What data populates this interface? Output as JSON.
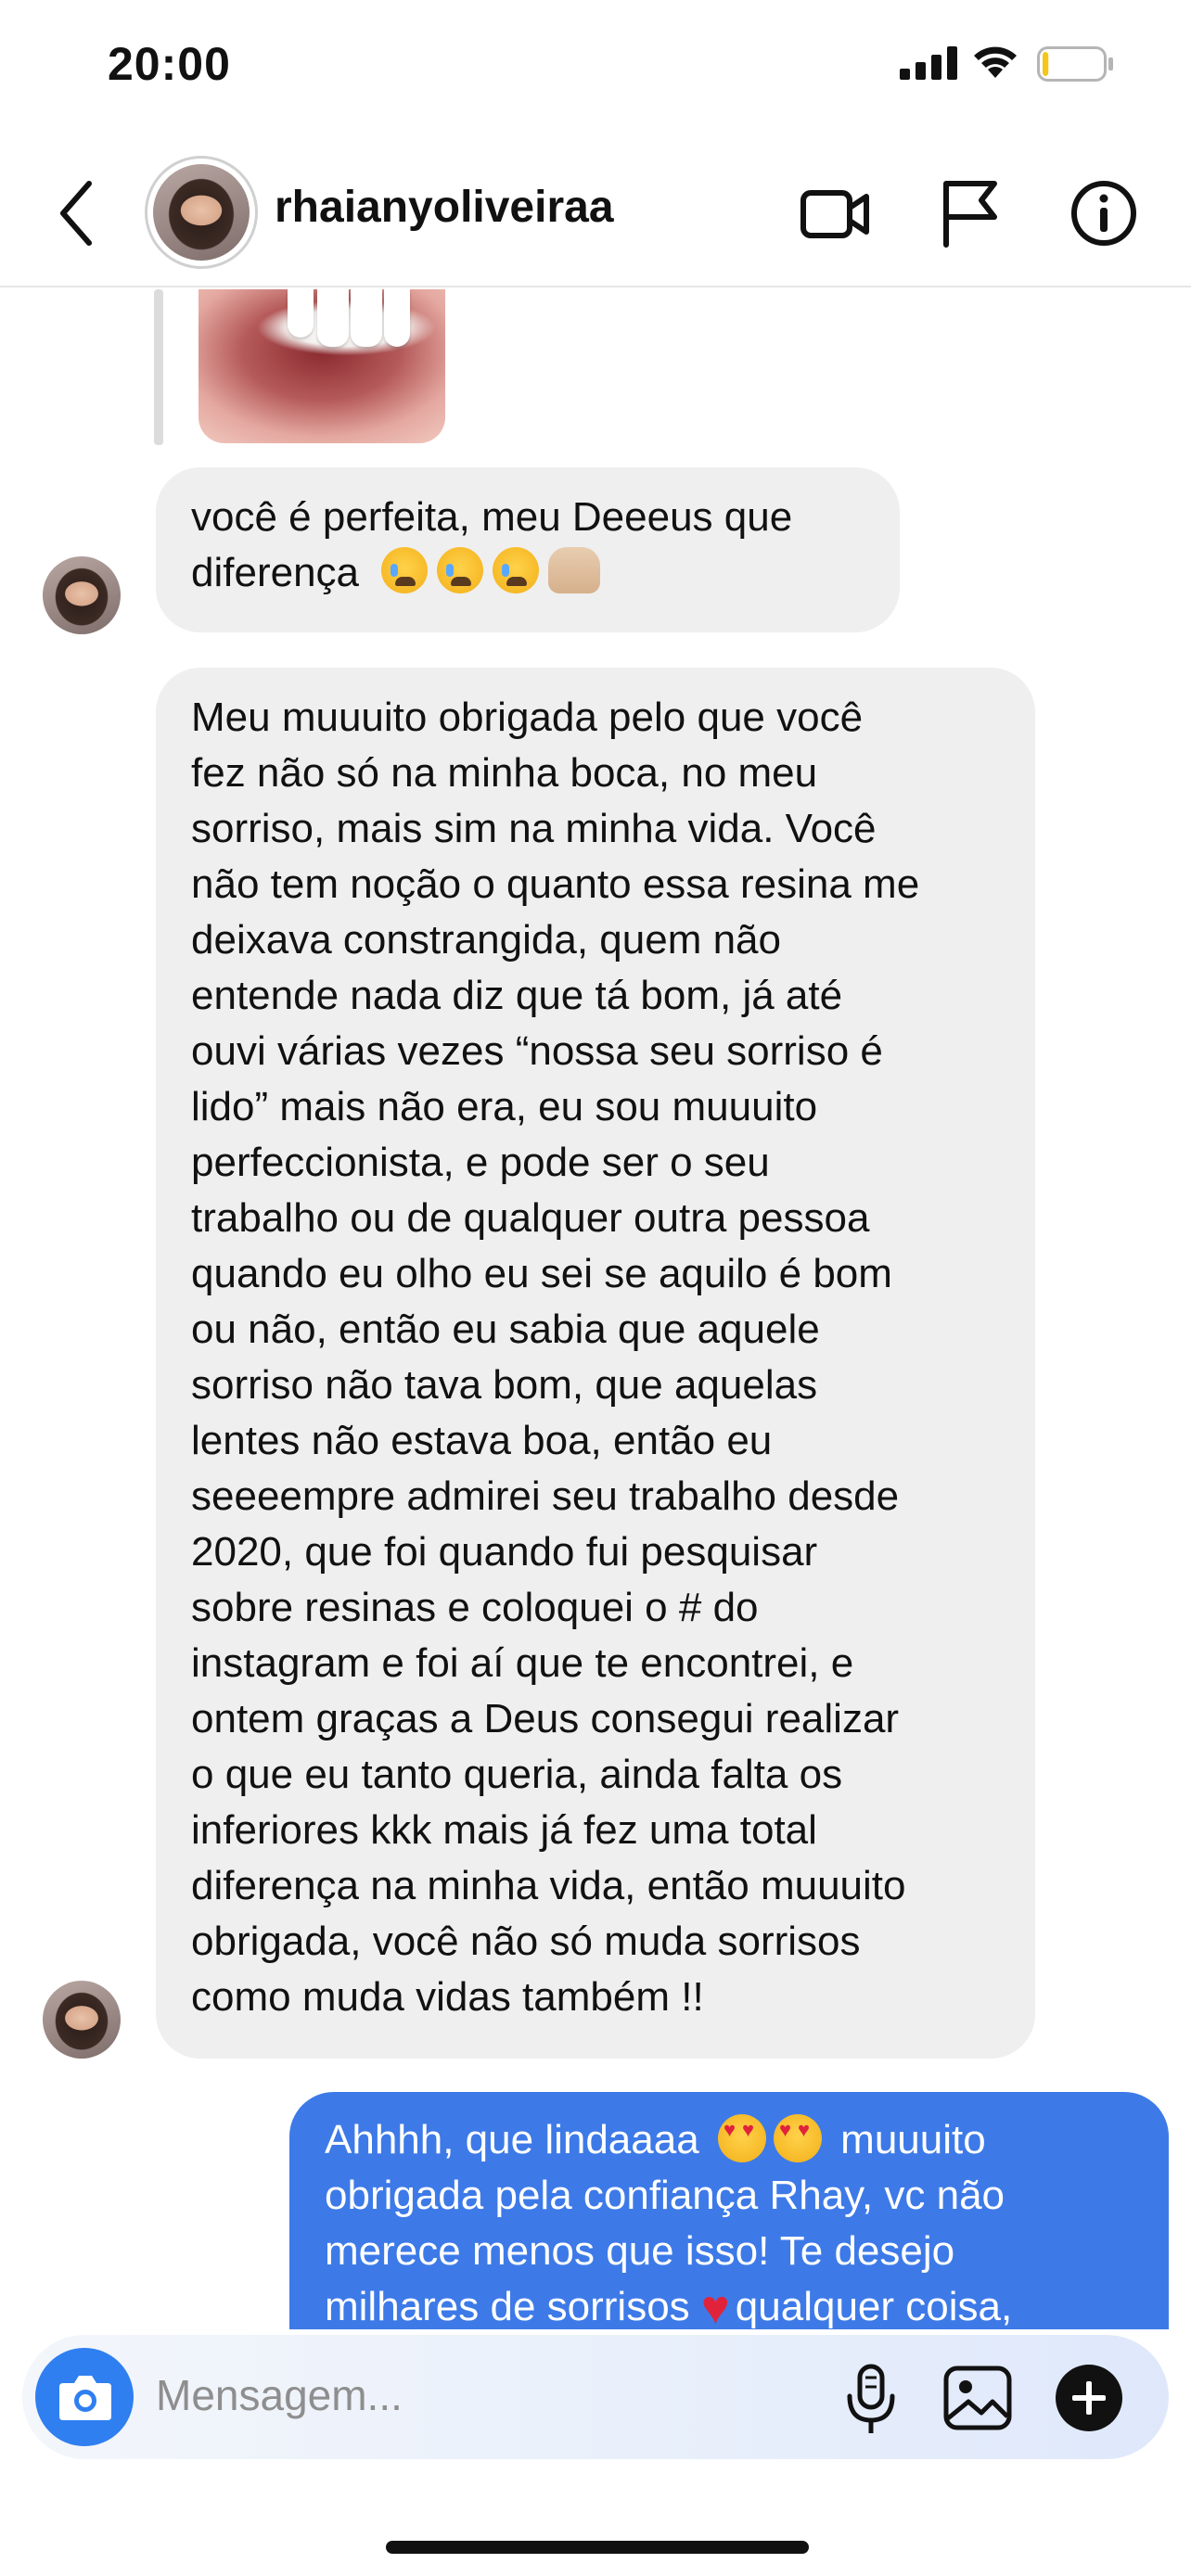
{
  "status_bar": {
    "time": "20:00",
    "signal_icon": "cellular-signal-icon",
    "wifi_icon": "wifi-icon",
    "battery_icon": "battery-icon",
    "battery_level": 0.1
  },
  "header": {
    "back_icon": "chevron-left-icon",
    "username": "rhaianyoliveiraa",
    "actions": [
      {
        "name": "video-call",
        "icon": "video-camera-icon"
      },
      {
        "name": "report",
        "icon": "flag-icon"
      },
      {
        "name": "info",
        "icon": "info-icon"
      }
    ]
  },
  "messages": [
    {
      "from": "them",
      "lines": [
        "você é perfeita, meu Deeeus que",
        "diferença"
      ],
      "emojis": [
        "loudly-crying-face",
        "loudly-crying-face",
        "loudly-crying-face",
        "raising-hands"
      ]
    },
    {
      "from": "them",
      "lines": [
        "Meu muuuito obrigada pelo que você",
        "fez não só na minha boca, no meu",
        "sorriso, mais sim na minha vida. Você",
        "não tem noção o quanto essa resina me",
        "deixava constrangida, quem não",
        "entende nada diz que tá bom, já até",
        "ouvi várias vezes “nossa seu sorriso é",
        "lido” mais não era, eu sou muuuito",
        "perfeccionista, e pode ser o seu",
        "trabalho ou de qualquer outra pessoa",
        "quando eu olho eu sei se aquilo é bom",
        "ou não, então eu sabia que aquele",
        "sorriso não tava bom, que aquelas",
        "lentes não estava boa, então eu",
        "seeeempre admirei seu trabalho desde",
        "2020, que foi quando fui pesquisar",
        "sobre resinas e coloquei o # do",
        "instagram e foi aí que te encontrei, e",
        "ontem graças a Deus consegui realizar",
        "o que eu tanto queria, ainda falta os",
        "inferiores kkk mais já fez uma total",
        "diferença na minha vida, então muuuito",
        "obrigada, você não só muda sorrisos",
        "como muda vidas também !!"
      ]
    },
    {
      "from": "me",
      "line1_a": "Ahhhh, que lindaaaa",
      "line1_b": "muuuito",
      "line2": "obrigada pela confiança Rhay, vc não",
      "line3": "merece menos que isso! Te desejo",
      "line4_a": "milhares de sorrisos",
      "line4_b": "qualquer coisa,",
      "emojis": [
        "smiling-face-with-heart-eyes",
        "smiling-face-with-heart-eyes",
        "red-heart"
      ]
    }
  ],
  "composer": {
    "placeholder": "Mensagem...",
    "camera_icon": "camera-icon",
    "mic_icon": "microphone-icon",
    "gallery_icon": "image-icon",
    "add_icon": "plus-circle-icon"
  }
}
